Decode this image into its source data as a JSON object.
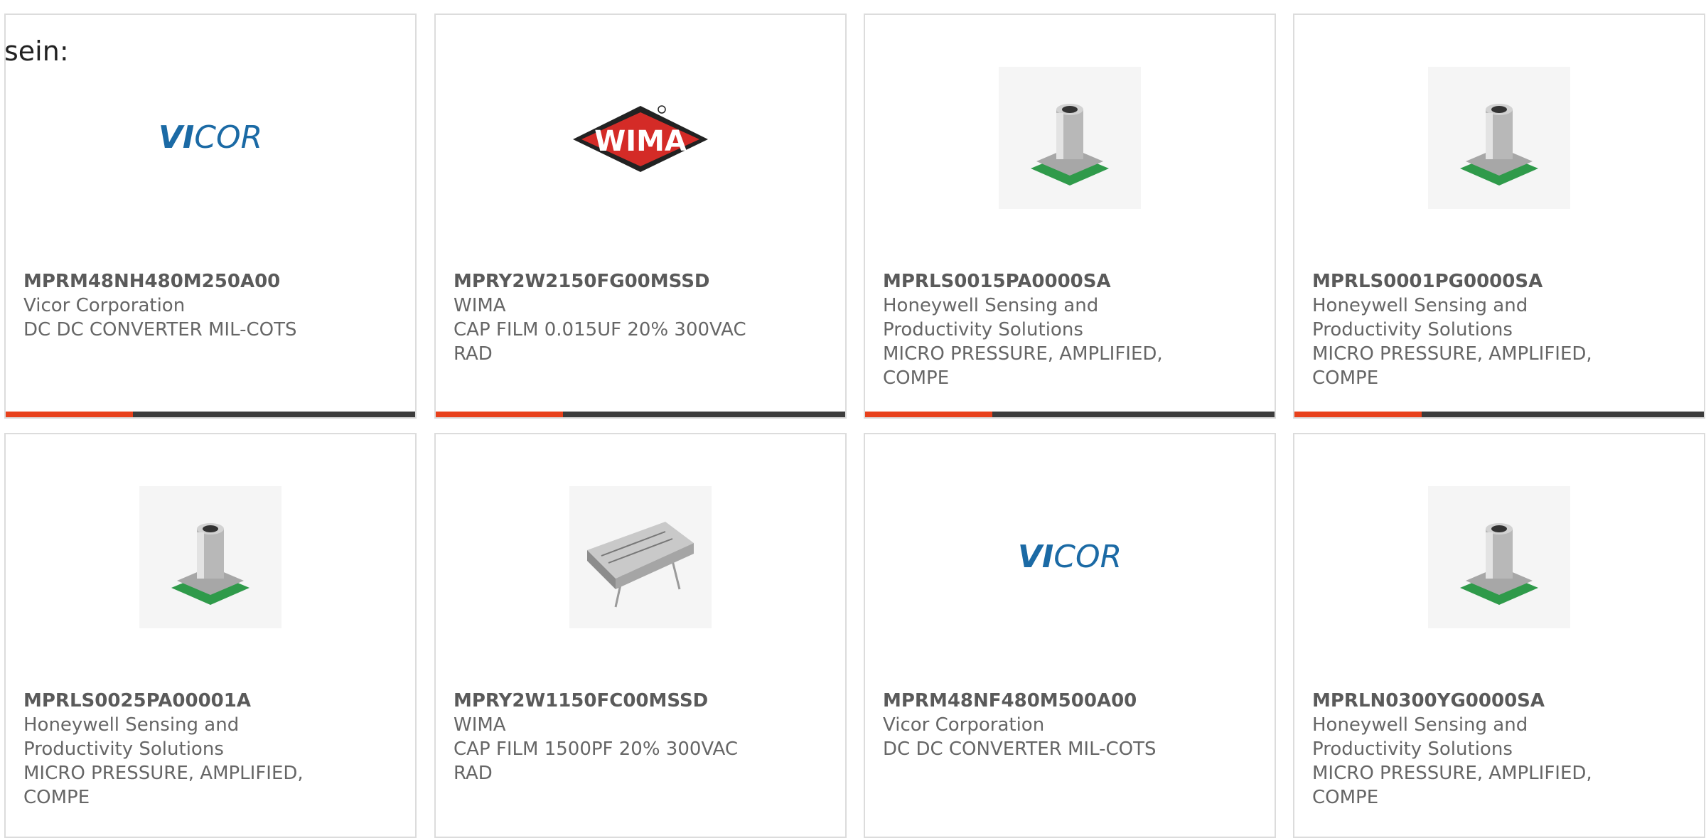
{
  "intro_text": "sein:",
  "colors": {
    "accent": "#e8411c",
    "track": "#3c3c3c",
    "card_border": "#dcdcdc",
    "vicor_blue": "#1b6aa5",
    "wima_red": "#d42b27"
  },
  "cards": [
    {
      "part_number": "MPRM48NH480M250A00",
      "manufacturer": "Vicor Corporation",
      "description": "DC DC CONVERTER MIL-COTS",
      "image": "vicor-logo",
      "progress": 0.31
    },
    {
      "part_number": "MPRY2W2150FG00MSSD",
      "manufacturer": "WIMA",
      "description": "CAP FILM 0.015UF 20% 300VAC RAD",
      "image": "wima-logo",
      "progress": 0.31
    },
    {
      "part_number": "MPRLS0015PA0000SA",
      "manufacturer": "Honeywell Sensing and Productivity Solutions",
      "description": "MICRO PRESSURE, AMPLIFIED, COMPE",
      "image": "pressure-sensor",
      "progress": 0.31
    },
    {
      "part_number": "MPRLS0001PG0000SA",
      "manufacturer": "Honeywell Sensing and Productivity Solutions",
      "description": "MICRO PRESSURE, AMPLIFIED, COMPE",
      "image": "pressure-sensor",
      "progress": 0.31
    },
    {
      "part_number": "MPRLS0025PA00001A",
      "manufacturer": "Honeywell Sensing and Productivity Solutions",
      "description": "MICRO PRESSURE, AMPLIFIED, COMPE",
      "image": "pressure-sensor",
      "progress": null
    },
    {
      "part_number": "MPRY2W1150FC00MSSD",
      "manufacturer": "WIMA",
      "description": "CAP FILM 1500PF 20% 300VAC RAD",
      "image": "film-capacitor",
      "progress": null
    },
    {
      "part_number": "MPRM48NF480M500A00",
      "manufacturer": "Vicor Corporation",
      "description": "DC DC CONVERTER MIL-COTS",
      "image": "vicor-logo",
      "progress": null
    },
    {
      "part_number": "MPRLN0300YG0000SA",
      "manufacturer": "Honeywell Sensing and Productivity Solutions",
      "description": "MICRO PRESSURE, AMPLIFIED, COMPE",
      "image": "pressure-sensor",
      "progress": null
    }
  ]
}
